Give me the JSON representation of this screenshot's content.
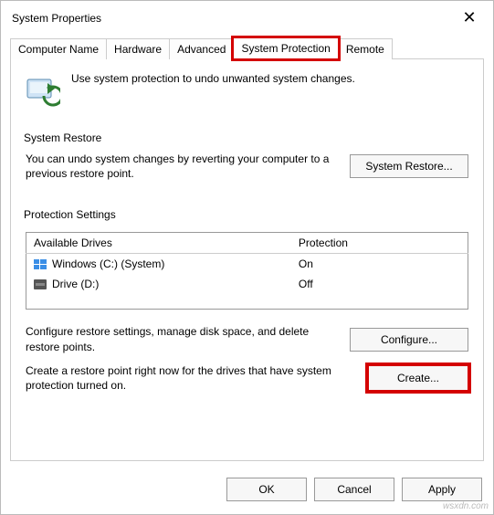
{
  "window": {
    "title": "System Properties",
    "close_glyph": "✕"
  },
  "tabs": {
    "t0": "Computer Name",
    "t1": "Hardware",
    "t2": "Advanced",
    "t3": "System Protection",
    "t4": "Remote"
  },
  "intro": {
    "text": "Use system protection to undo unwanted system changes."
  },
  "restore_group": {
    "label": "System Restore",
    "desc": "You can undo system changes by reverting your computer to a previous restore point.",
    "button": "System Restore..."
  },
  "protection_group": {
    "label": "Protection Settings",
    "col_drives": "Available Drives",
    "col_prot": "Protection",
    "drives": [
      {
        "name": "Windows (C:) (System)",
        "protection": "On",
        "icon": "win"
      },
      {
        "name": "Drive (D:)",
        "protection": "Off",
        "icon": "hdd"
      }
    ],
    "configure_desc": "Configure restore settings, manage disk space, and delete restore points.",
    "configure_btn": "Configure...",
    "create_desc": "Create a restore point right now for the drives that have system protection turned on.",
    "create_btn": "Create..."
  },
  "buttons": {
    "ok": "OK",
    "cancel": "Cancel",
    "apply": "Apply"
  },
  "watermark": "wsxdn.com"
}
